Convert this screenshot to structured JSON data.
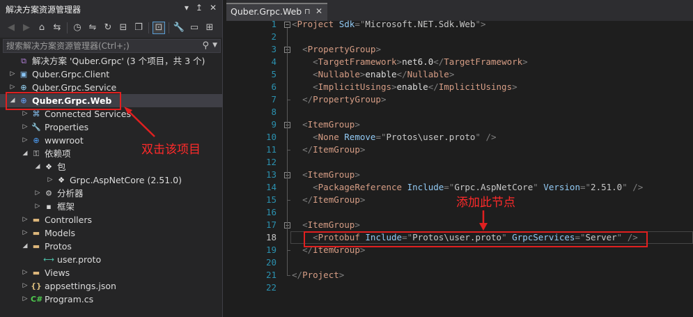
{
  "explorer": {
    "title": "解决方案资源管理器",
    "title_buttons": [
      "▾",
      "↥",
      "✕"
    ],
    "search_placeholder": "搜索解决方案资源管理器(Ctrl+;)",
    "tree": [
      {
        "label": "解决方案 'Quber.Grpc' (3 个项目，共 3 个)",
        "icon": "solution-icon",
        "glyph": "⧉",
        "arrow": "",
        "indent": 0
      },
      {
        "label": "Quber.Grpc.Client",
        "icon": "console-project-icon",
        "glyph": "▣",
        "arrow": "▷",
        "indent": 0
      },
      {
        "label": "Quber.Grpc.Service",
        "icon": "service-project-icon",
        "glyph": "⊕",
        "arrow": "▷",
        "indent": 0
      },
      {
        "label": "Quber.Grpc.Web",
        "icon": "web-project-icon",
        "glyph": "⊕",
        "arrow": "◢",
        "indent": 0,
        "selected": true
      },
      {
        "label": "Connected Services",
        "icon": "connected-services-icon",
        "glyph": "⌘",
        "arrow": "▷",
        "indent": 1
      },
      {
        "label": "Properties",
        "icon": "properties-icon",
        "glyph": "🔧",
        "arrow": "▷",
        "indent": 1
      },
      {
        "label": "wwwroot",
        "icon": "globe-icon",
        "glyph": "⊕",
        "arrow": "▷",
        "indent": 1
      },
      {
        "label": "依赖项",
        "icon": "dependencies-icon",
        "glyph": "⚿",
        "arrow": "◢",
        "indent": 1
      },
      {
        "label": "包",
        "icon": "packages-icon",
        "glyph": "❖",
        "arrow": "◢",
        "indent": 2
      },
      {
        "label": "Grpc.AspNetCore (2.51.0)",
        "icon": "package-icon",
        "glyph": "❖",
        "arrow": "▷",
        "indent": 3
      },
      {
        "label": "分析器",
        "icon": "analyzers-icon",
        "glyph": "⚙",
        "arrow": "▷",
        "indent": 2
      },
      {
        "label": "框架",
        "icon": "framework-icon",
        "glyph": "▪",
        "arrow": "▷",
        "indent": 2
      },
      {
        "label": "Controllers",
        "icon": "folder-icon",
        "glyph": "▬",
        "arrow": "▷",
        "indent": 1
      },
      {
        "label": "Models",
        "icon": "folder-icon",
        "glyph": "▬",
        "arrow": "▷",
        "indent": 1
      },
      {
        "label": "Protos",
        "icon": "folder-open-icon",
        "glyph": "▬",
        "arrow": "◢",
        "indent": 1
      },
      {
        "label": "user.proto",
        "icon": "proto-file-icon",
        "glyph": "⟷",
        "arrow": "",
        "indent": 2
      },
      {
        "label": "Views",
        "icon": "folder-icon",
        "glyph": "▬",
        "arrow": "▷",
        "indent": 1
      },
      {
        "label": "appsettings.json",
        "icon": "json-file-icon",
        "glyph": "{}",
        "arrow": "▷",
        "indent": 1
      },
      {
        "label": "Program.cs",
        "icon": "csharp-file-icon",
        "glyph": "C#",
        "arrow": "▷",
        "indent": 1
      }
    ]
  },
  "editor": {
    "tab_title": "Quber.Grpc.Web",
    "tab_pin": "⊓",
    "tab_close": "✕",
    "current_line": 18,
    "lines": [
      {
        "n": 1,
        "segs": [
          [
            "b",
            "<"
          ],
          [
            "tag",
            "Project"
          ],
          [
            "t",
            " "
          ],
          [
            "attr",
            "Sdk"
          ],
          [
            "b",
            "=\""
          ],
          [
            "val",
            "Microsoft.NET.Sdk.Web"
          ],
          [
            "b",
            "\">"
          ]
        ]
      },
      {
        "n": 2,
        "segs": []
      },
      {
        "n": 3,
        "segs": [
          [
            "t",
            "  "
          ],
          [
            "b",
            "<"
          ],
          [
            "tag",
            "PropertyGroup"
          ],
          [
            "b",
            ">"
          ]
        ]
      },
      {
        "n": 4,
        "segs": [
          [
            "t",
            "    "
          ],
          [
            "b",
            "<"
          ],
          [
            "tag",
            "TargetFramework"
          ],
          [
            "b",
            ">"
          ],
          [
            "t",
            "net6.0"
          ],
          [
            "b",
            "</"
          ],
          [
            "tag",
            "TargetFramework"
          ],
          [
            "b",
            ">"
          ]
        ]
      },
      {
        "n": 5,
        "segs": [
          [
            "t",
            "    "
          ],
          [
            "b",
            "<"
          ],
          [
            "tag",
            "Nullable"
          ],
          [
            "b",
            ">"
          ],
          [
            "t",
            "enable"
          ],
          [
            "b",
            "</"
          ],
          [
            "tag",
            "Nullable"
          ],
          [
            "b",
            ">"
          ]
        ]
      },
      {
        "n": 6,
        "segs": [
          [
            "t",
            "    "
          ],
          [
            "b",
            "<"
          ],
          [
            "tag",
            "ImplicitUsings"
          ],
          [
            "b",
            ">"
          ],
          [
            "t",
            "enable"
          ],
          [
            "b",
            "</"
          ],
          [
            "tag",
            "ImplicitUsings"
          ],
          [
            "b",
            ">"
          ]
        ]
      },
      {
        "n": 7,
        "segs": [
          [
            "t",
            "  "
          ],
          [
            "b",
            "</"
          ],
          [
            "tag",
            "PropertyGroup"
          ],
          [
            "b",
            ">"
          ]
        ]
      },
      {
        "n": 8,
        "segs": []
      },
      {
        "n": 9,
        "segs": [
          [
            "t",
            "  "
          ],
          [
            "b",
            "<"
          ],
          [
            "tag",
            "ItemGroup"
          ],
          [
            "b",
            ">"
          ]
        ]
      },
      {
        "n": 10,
        "segs": [
          [
            "t",
            "    "
          ],
          [
            "b",
            "<"
          ],
          [
            "tag",
            "None"
          ],
          [
            "t",
            " "
          ],
          [
            "attr",
            "Remove"
          ],
          [
            "b",
            "=\""
          ],
          [
            "val",
            "Protos\\user.proto"
          ],
          [
            "b",
            "\" />"
          ]
        ]
      },
      {
        "n": 11,
        "segs": [
          [
            "t",
            "  "
          ],
          [
            "b",
            "</"
          ],
          [
            "tag",
            "ItemGroup"
          ],
          [
            "b",
            ">"
          ]
        ]
      },
      {
        "n": 12,
        "segs": []
      },
      {
        "n": 13,
        "segs": [
          [
            "t",
            "  "
          ],
          [
            "b",
            "<"
          ],
          [
            "tag",
            "ItemGroup"
          ],
          [
            "b",
            ">"
          ]
        ]
      },
      {
        "n": 14,
        "segs": [
          [
            "t",
            "    "
          ],
          [
            "b",
            "<"
          ],
          [
            "tag",
            "PackageReference"
          ],
          [
            "t",
            " "
          ],
          [
            "attr",
            "Include"
          ],
          [
            "b",
            "=\""
          ],
          [
            "val",
            "Grpc.AspNetCore"
          ],
          [
            "b",
            "\""
          ],
          [
            "t",
            " "
          ],
          [
            "attr",
            "Version"
          ],
          [
            "b",
            "=\""
          ],
          [
            "val",
            "2.51.0"
          ],
          [
            "b",
            "\" />"
          ]
        ]
      },
      {
        "n": 15,
        "segs": [
          [
            "t",
            "  "
          ],
          [
            "b",
            "</"
          ],
          [
            "tag",
            "ItemGroup"
          ],
          [
            "b",
            ">"
          ]
        ]
      },
      {
        "n": 16,
        "segs": []
      },
      {
        "n": 17,
        "segs": [
          [
            "t",
            "  "
          ],
          [
            "b",
            "<"
          ],
          [
            "tag",
            "ItemGroup"
          ],
          [
            "b",
            ">"
          ]
        ]
      },
      {
        "n": 18,
        "segs": [
          [
            "t",
            "    "
          ],
          [
            "b",
            "<"
          ],
          [
            "tag",
            "Protobuf"
          ],
          [
            "t",
            " "
          ],
          [
            "attr",
            "Include"
          ],
          [
            "b",
            "=\""
          ],
          [
            "val",
            "Protos\\user.proto"
          ],
          [
            "b",
            "\""
          ],
          [
            "t",
            " "
          ],
          [
            "attr",
            "GrpcServices"
          ],
          [
            "b",
            "=\""
          ],
          [
            "val",
            "Server"
          ],
          [
            "b",
            "\" />"
          ]
        ]
      },
      {
        "n": 19,
        "segs": [
          [
            "t",
            "  "
          ],
          [
            "b",
            "</"
          ],
          [
            "tag",
            "ItemGroup"
          ],
          [
            "b",
            ">"
          ]
        ]
      },
      {
        "n": 20,
        "segs": []
      },
      {
        "n": 21,
        "segs": [
          [
            "b",
            "</"
          ],
          [
            "tag",
            "Project"
          ],
          [
            "b",
            ">"
          ]
        ]
      },
      {
        "n": 22,
        "segs": []
      }
    ]
  },
  "annotations": {
    "double_click": "双击该项目",
    "add_node": "添加此节点"
  },
  "colors": {
    "annotation_red": "#e02020",
    "xml_tag": "#d69d85",
    "xml_attr": "#92caf4",
    "line_number": "#2b91af"
  }
}
